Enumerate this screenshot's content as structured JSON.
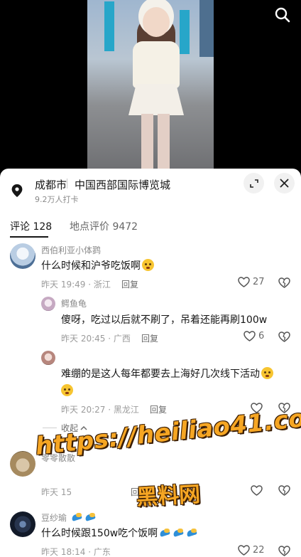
{
  "video": {
    "search_icon": "search-icon"
  },
  "location": {
    "city": "成都市",
    "venue": "中国西部国际博览城",
    "checkins": "9.2万人打卡"
  },
  "tabs": [
    {
      "label": "评论 128",
      "active": true
    },
    {
      "label": "地点评价 9472",
      "active": false
    }
  ],
  "comments": [
    {
      "user": "西伯利亚小体鹨",
      "text": "什么时候和沪爷吃饭啊",
      "emoji": "crying-face",
      "meta": "昨天 19:49 · 浙江",
      "reply": "回复",
      "likes": "27"
    },
    {
      "user": "鳄鱼龟",
      "text": "傻呀，吃过以后就不刷了，吊着还能再刷100w",
      "meta": "昨天 20:45 · 广西",
      "reply": "回复",
      "likes": "6"
    },
    {
      "user": "",
      "text": "难绷的是这人每年都要去上海好几次线下活动",
      "emoji": "pleading-face",
      "meta": "昨天 20:27 · 黑龙江",
      "reply": "回复",
      "likes": ""
    },
    {
      "user": "零零散散",
      "text": "",
      "meta": "昨天 15",
      "reply": "回复",
      "likes": ""
    },
    {
      "user": "豆纱瑜",
      "text": "什么时候跟150w吃个饭啊",
      "meta": "昨天 18:14 · 广东",
      "reply": "回复",
      "likes": "22"
    }
  ],
  "collapse_label": "收起",
  "watermark": {
    "url": "https://heiliao41.com",
    "name": "黑料网"
  },
  "colors": {
    "watermark": "#f6a623",
    "text": "#161616",
    "muted": "#9b9b9b"
  }
}
